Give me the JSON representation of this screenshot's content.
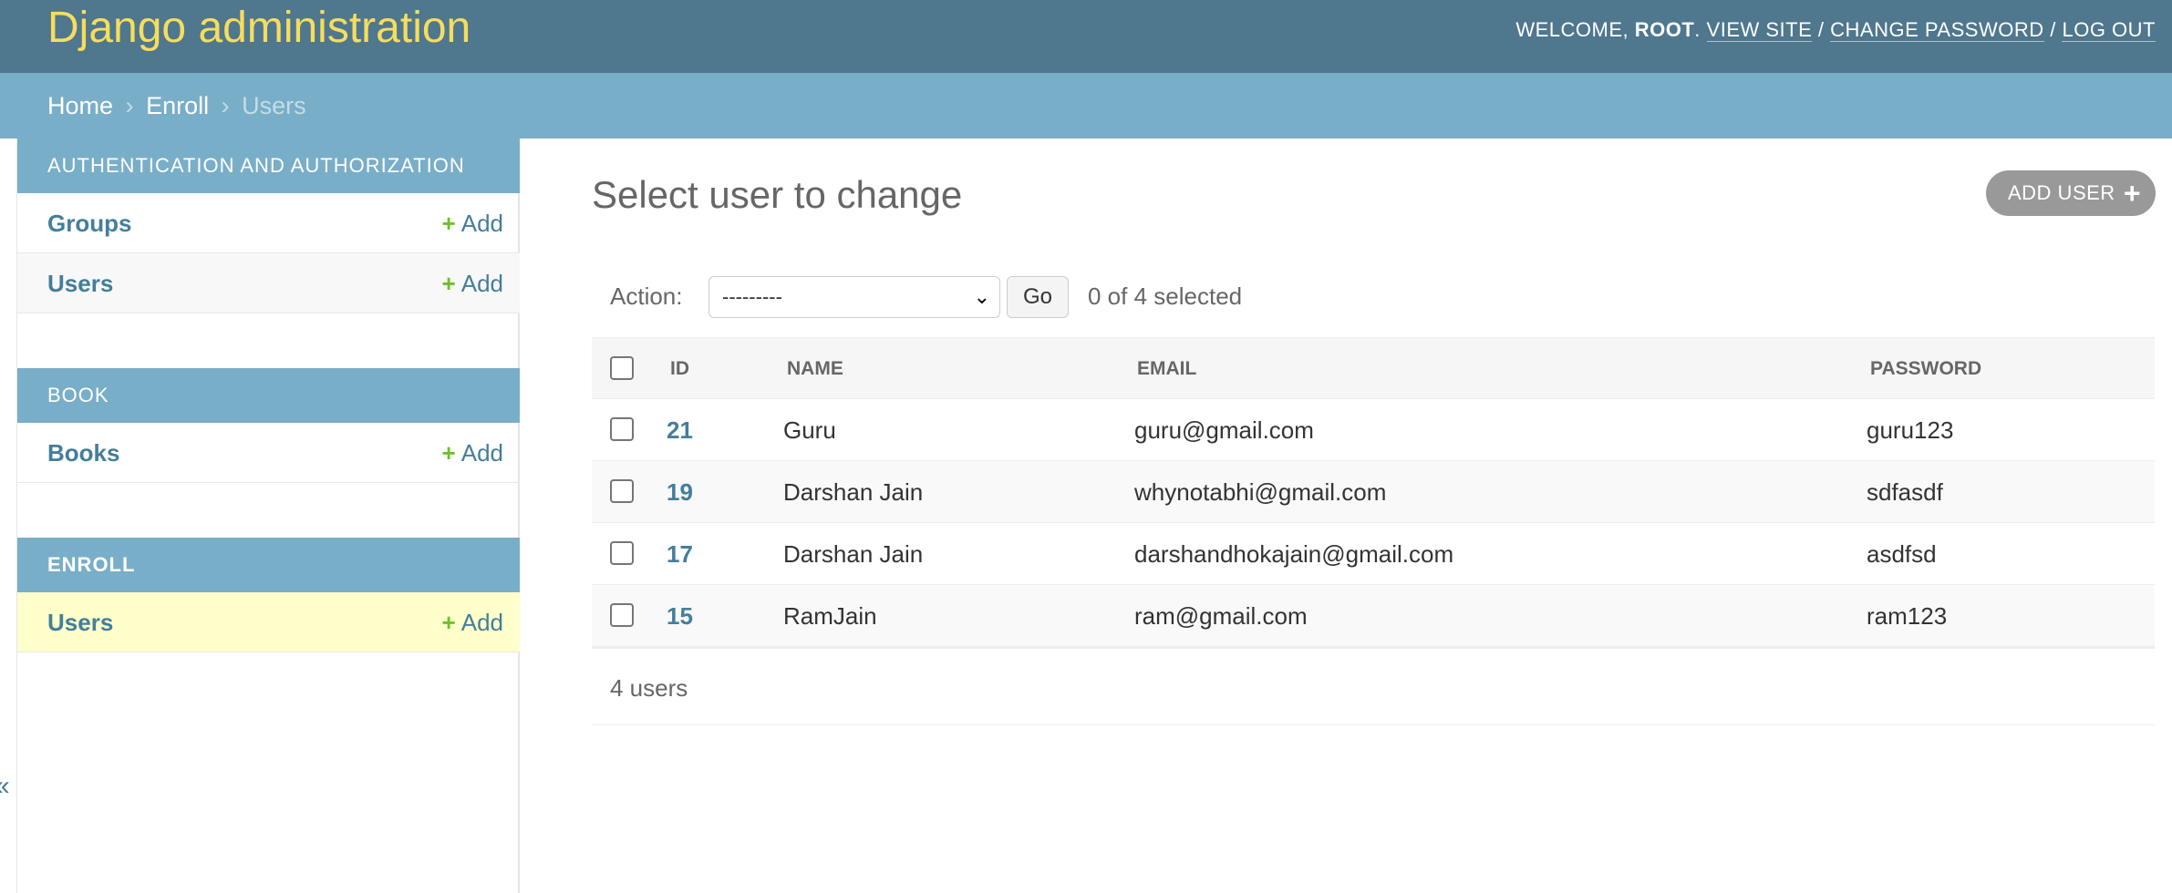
{
  "header": {
    "branding": "Django administration",
    "welcome": "Welcome,",
    "username": "root",
    "view_site": "View site",
    "change_password": "Change password",
    "log_out": "Log out",
    "separator": "/"
  },
  "breadcrumbs": {
    "home": "Home",
    "app": "Enroll",
    "current": "Users",
    "separator": "›"
  },
  "sidebar": {
    "toggle_glyph": "«",
    "add_label": "Add",
    "apps": [
      {
        "caption": "Authentication and Authorization",
        "models": [
          {
            "name": "Groups"
          },
          {
            "name": "Users"
          }
        ]
      },
      {
        "caption": "Book",
        "models": [
          {
            "name": "Books"
          }
        ]
      },
      {
        "caption": "Enroll",
        "current": true,
        "models": [
          {
            "name": "Users",
            "selected": true
          }
        ]
      }
    ]
  },
  "main": {
    "title": "Select user to change",
    "add_button": "Add user",
    "actions": {
      "label": "Action:",
      "select_value": "---------",
      "go_label": "Go",
      "counter": "0 of 4 selected"
    },
    "table": {
      "columns": [
        "ID",
        "Name",
        "Email",
        "Password"
      ],
      "rows": [
        {
          "id": "21",
          "name": "Guru",
          "email": "guru@gmail.com",
          "password": "guru123"
        },
        {
          "id": "19",
          "name": "Darshan Jain",
          "email": "whynotabhi@gmail.com",
          "password": "sdfasdf"
        },
        {
          "id": "17",
          "name": "Darshan Jain",
          "email": "darshandhokajain@gmail.com",
          "password": "asdfsd"
        },
        {
          "id": "15",
          "name": "RamJain",
          "email": "ram@gmail.com",
          "password": "ram123"
        }
      ]
    },
    "paginator": "4 users"
  },
  "colors": {
    "header_bg": "#4f778e",
    "branding": "#f5dd5d",
    "breadcrumb_bg": "#79aec8",
    "link": "#447e9b",
    "add_plus": "#70bf2b",
    "selected_row": "#ffffcc"
  }
}
